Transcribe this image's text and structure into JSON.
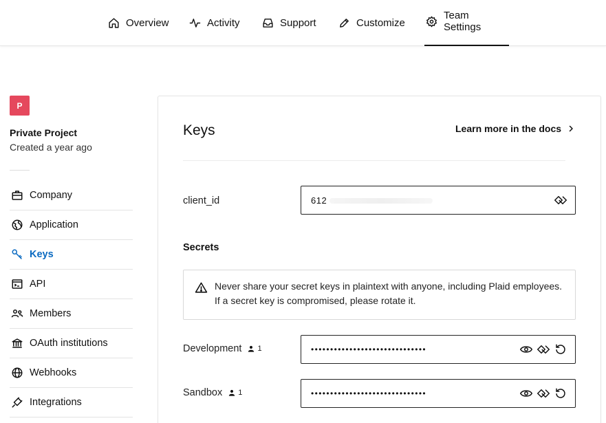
{
  "nav": {
    "items": [
      {
        "label": "Overview",
        "icon": "home-icon"
      },
      {
        "label": "Activity",
        "icon": "activity-icon"
      },
      {
        "label": "Support",
        "icon": "inbox-icon"
      },
      {
        "label": "Customize",
        "icon": "pencil-icon"
      },
      {
        "label": "Team Settings",
        "icon": "gear-icon",
        "active": true
      }
    ]
  },
  "project": {
    "avatar_letter": "P",
    "avatar_color": "#e5485d",
    "name": "Private Project",
    "subtitle": "Created a year ago"
  },
  "sidebar": {
    "items": [
      {
        "label": "Company",
        "icon": "briefcase-icon"
      },
      {
        "label": "Application",
        "icon": "globe-icon"
      },
      {
        "label": "Keys",
        "icon": "key-icon",
        "active": true
      },
      {
        "label": "API",
        "icon": "terminal-icon"
      },
      {
        "label": "Members",
        "icon": "users-icon"
      },
      {
        "label": "OAuth institutions",
        "icon": "bank-icon"
      },
      {
        "label": "Webhooks",
        "icon": "web-icon"
      },
      {
        "label": "Integrations",
        "icon": "plug-icon"
      }
    ],
    "active_color": "#0a6ac1"
  },
  "main": {
    "title": "Keys",
    "docs_link": "Learn more in the docs",
    "client_id": {
      "label": "client_id",
      "value": "612"
    },
    "secrets_heading": "Secrets",
    "warning": "Never share your secret keys in plaintext with anyone, including Plaid employees. If a secret key is compromised, please rotate it.",
    "secrets": [
      {
        "label": "Development",
        "count": "1",
        "masked": "••••••••••••••••••••••••••••••"
      },
      {
        "label": "Sandbox",
        "count": "1",
        "masked": "••••••••••••••••••••••••••••••"
      }
    ]
  }
}
